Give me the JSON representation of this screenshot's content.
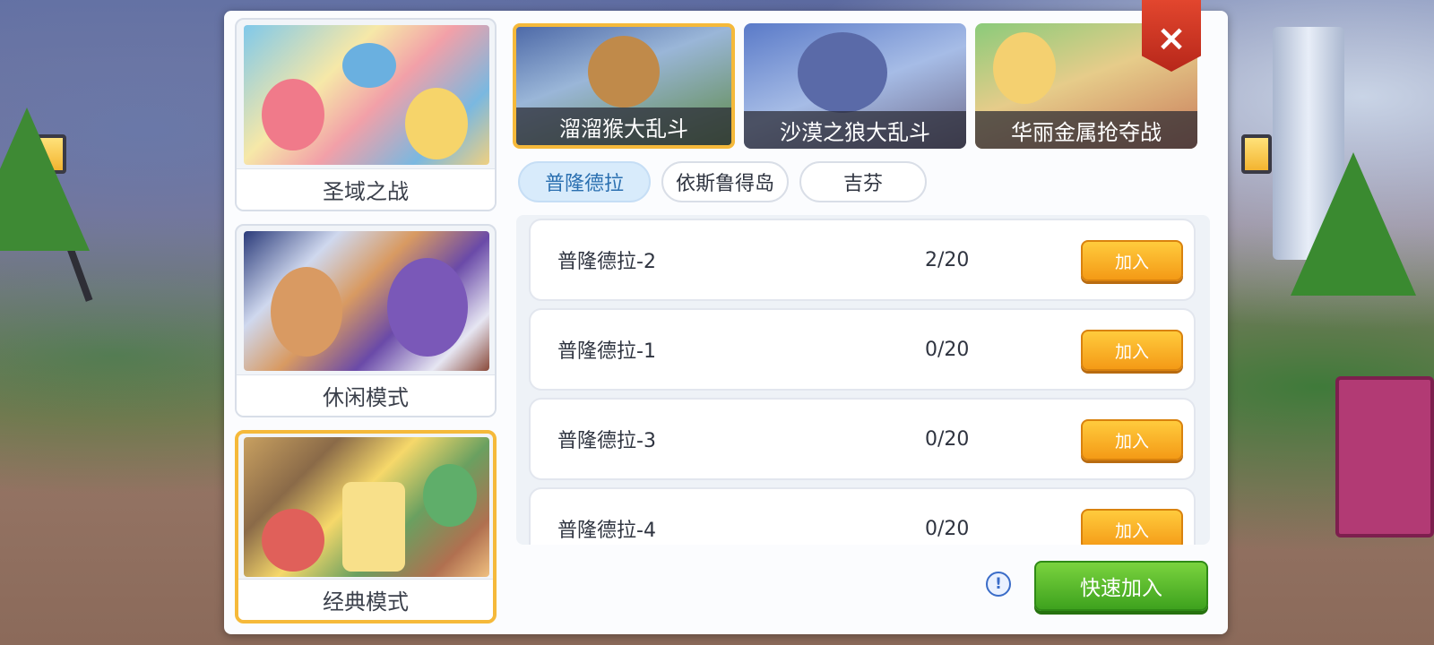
{
  "modes": [
    {
      "label": "圣域之战",
      "selected": false
    },
    {
      "label": "休闲模式",
      "selected": false
    },
    {
      "label": "经典模式",
      "selected": true
    }
  ],
  "events": [
    {
      "label": "溜溜猴大乱斗",
      "selected": true
    },
    {
      "label": "沙漠之狼大乱斗",
      "selected": false
    },
    {
      "label": "华丽金属抢夺战",
      "selected": false
    }
  ],
  "tabs": [
    {
      "label": "普隆德拉",
      "active": true
    },
    {
      "label": "依斯鲁得岛",
      "active": false
    },
    {
      "label": "吉芬",
      "active": false
    }
  ],
  "rooms": [
    {
      "name": "普隆德拉-2",
      "count": "2/20",
      "join_label": "加入"
    },
    {
      "name": "普隆德拉-1",
      "count": "0/20",
      "join_label": "加入"
    },
    {
      "name": "普隆德拉-3",
      "count": "0/20",
      "join_label": "加入"
    },
    {
      "name": "普隆德拉-4",
      "count": "0/20",
      "join_label": "加入"
    }
  ],
  "close_icon": "×",
  "info_icon": "!",
  "quick_join_label": "快速加入",
  "colors": {
    "selected_border": "#f5b93a",
    "join_button": "#f49a16",
    "quick_join_button": "#3ea21e",
    "close_button": "#d23a24",
    "active_tab": "#d8ebfb"
  }
}
